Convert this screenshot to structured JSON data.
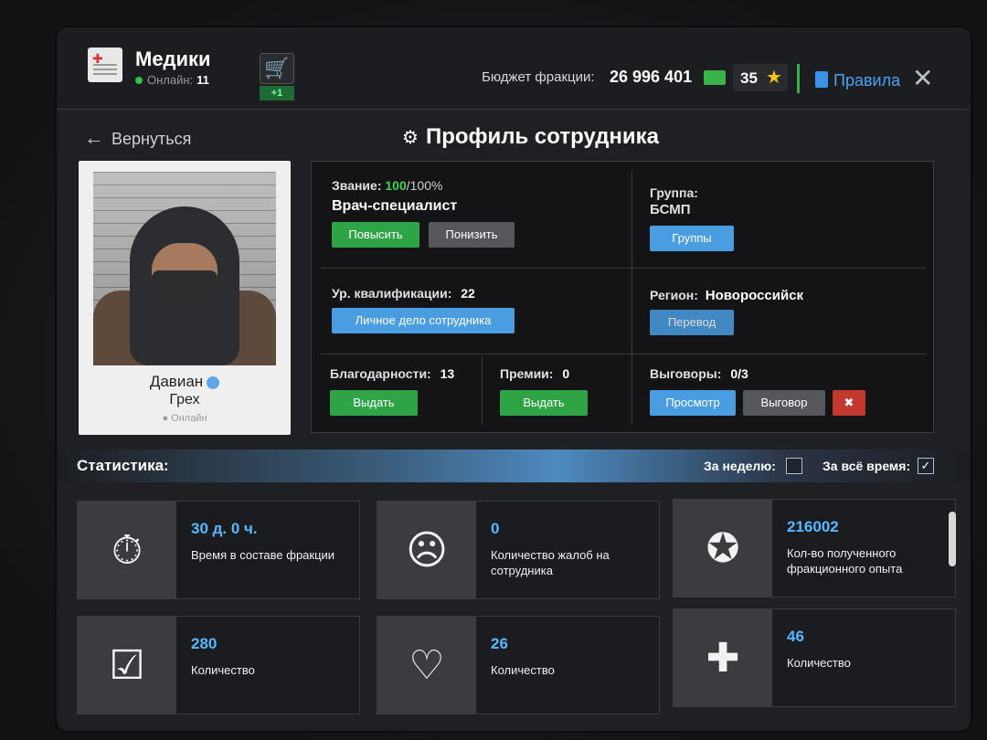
{
  "header": {
    "faction_name": "Медики",
    "online_label": "Онлайн:",
    "online_count": "11",
    "cart_badge": "+1",
    "budget_label": "Бюджет фракции:",
    "budget_value": "26 996 401",
    "stars_value": "35",
    "rules_label": "Правила"
  },
  "nav": {
    "back_label": "Вернуться",
    "page_title": "Профиль сотрудника"
  },
  "profile": {
    "first_name": "Давиан",
    "last_name": "Грех",
    "status": "Онлайн"
  },
  "info": {
    "rank_label": "Звание:",
    "rank_percent": "100",
    "rank_max": "/100%",
    "rank_title": "Врач-специалист",
    "promote_label": "Повысить",
    "demote_label": "Понизить",
    "group_label": "Группа:",
    "group_value": "БСМП",
    "groups_button": "Группы",
    "qualification_label": "Ур. квалификации:",
    "qualification_value": "22",
    "personal_file_button": "Личное дело сотрудника",
    "region_label": "Регион:",
    "region_value": "Новороссийск",
    "transfer_button": "Перевод",
    "thanks_label": "Благодарности:",
    "thanks_value": "13",
    "thanks_button": "Выдать",
    "bonus_label": "Премии:",
    "bonus_value": "0",
    "bonus_button": "Выдать",
    "reprimand_label": "Выговоры:",
    "reprimand_value": "0/3",
    "view_button": "Просмотр",
    "reprimand_button": "Выговор"
  },
  "stats": {
    "title": "Статистика:",
    "week_label": "За неделю:",
    "all_time_label": "За всё время:",
    "all_time_check": "✓",
    "cards": [
      {
        "value": "30 д. 0 ч.",
        "label": "Время в составе фракции",
        "icon": "stopwatch-icon",
        "glyph": "⏱"
      },
      {
        "value": "0",
        "label": "Количество жалоб на сотрудника",
        "icon": "complaint-document-icon",
        "glyph": "☹"
      },
      {
        "value": "216002",
        "label": "Кол-во полученного фракционного опыта",
        "icon": "exp-stars-icon",
        "glyph": "✪"
      },
      {
        "value": "280",
        "label": "Количество",
        "icon": "clipboard-checklist-icon",
        "glyph": "☑"
      },
      {
        "value": "26",
        "label": "Количество",
        "icon": "heart-pulse-icon",
        "glyph": "♡"
      },
      {
        "value": "46",
        "label": "Количество",
        "icon": "medkit-icon",
        "glyph": "✚"
      }
    ]
  },
  "colors": {
    "accent_green": "#2fa447",
    "accent_blue": "#4a9de0",
    "danger_red": "#c4392f",
    "stat_value_blue": "#59b7ff"
  }
}
